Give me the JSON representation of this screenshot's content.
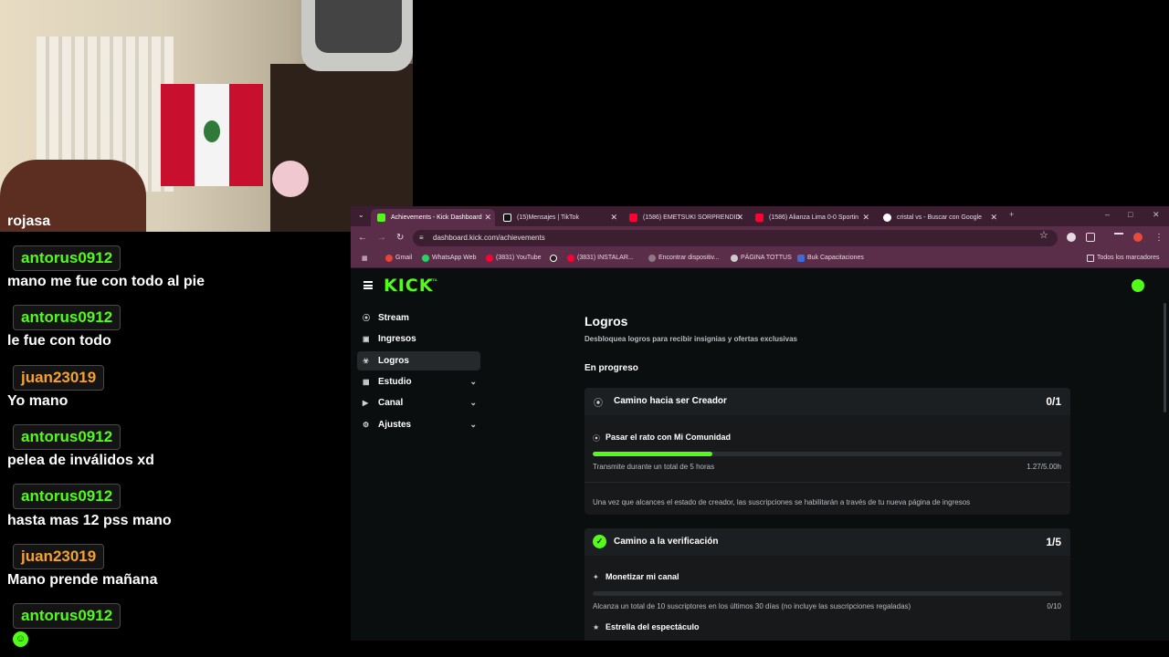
{
  "webcam": {},
  "chat": {
    "messages": [
      {
        "user": "",
        "text": "rojasa"
      },
      {
        "user": "antorus0912",
        "text": "mano me fue con todo al pie",
        "color": "#53fc18"
      },
      {
        "user": "antorus0912",
        "text": "le fue con todo",
        "color": "#53fc18"
      },
      {
        "user": "juan23019",
        "text": "Yo mano",
        "color": "#f3a32d"
      },
      {
        "user": "antorus0912",
        "text": "pelea de inválidos xd",
        "color": "#53fc18"
      },
      {
        "user": "antorus0912",
        "text": "hasta mas 12 pss mano",
        "color": "#53fc18"
      },
      {
        "user": "juan23019",
        "text": "Mano prende mañana",
        "color": "#f3a32d"
      },
      {
        "user": "antorus0912",
        "text": "",
        "color": "#53fc18"
      }
    ],
    "emote_icon": "smile-emote-icon"
  },
  "browser": {
    "tabs": [
      {
        "label": "Achievements - Kick Dashboard",
        "icon": "kick-icon",
        "active": true
      },
      {
        "label": "(15)Mensajes | TikTok",
        "icon": "tiktok-icon"
      },
      {
        "label": "(1586) EMETSUKI SORPRENDID",
        "icon": "youtube-icon"
      },
      {
        "label": "(1586) Alianza Lima 0-0 Sportin",
        "icon": "youtube-icon"
      },
      {
        "label": "cristal vs - Buscar con Google",
        "icon": "google-icon"
      }
    ],
    "url": "dashboard.kick.com/achievements",
    "bookmarks": [
      "Gmail",
      "WhatsApp Web",
      "(3831) YouTube",
      "",
      "(3831) INSTALAR...",
      "Encontrar dispositiv...",
      "PÁGINA TOTTUS",
      "Buk Capacitaciones",
      "Todos los marcadores"
    ]
  },
  "kick": {
    "logo": "KICK",
    "beta": "BETA",
    "sidebar": [
      {
        "label": "Stream",
        "icon": "broadcast-icon"
      },
      {
        "label": "Ingresos",
        "icon": "wallet-icon"
      },
      {
        "label": "Logros",
        "icon": "trophy-icon",
        "active": true
      },
      {
        "label": "Estudio",
        "icon": "studio-icon",
        "expandable": true
      },
      {
        "label": "Canal",
        "icon": "channel-icon",
        "expandable": true
      },
      {
        "label": "Ajustes",
        "icon": "gear-icon",
        "expandable": true
      }
    ],
    "page_title": "Logros",
    "page_subtitle": "Desbloquea logros para recibir insignias y ofertas exclusivas",
    "section_title": "En progreso",
    "cards": [
      {
        "title": "Camino hacia ser Creador",
        "count": "0/1",
        "tasks": [
          {
            "title": "Pasar el rato con Mi Comunidad",
            "desc": "Transmite durante un total de 5 horas",
            "value": "1.27/5.00h",
            "progress": 0.254
          }
        ],
        "note": "Una vez que alcances el estado de creador, las suscripciones se habilitarán a través de tu nueva página de ingresos"
      },
      {
        "title": "Camino a la verificación",
        "count": "1/5",
        "tasks": [
          {
            "title": "Monetizar mi canal",
            "desc": "Alcanza un total de 10 suscriptores en los últimos 30 días (no incluye las suscripciones regaladas)",
            "value": "0/10",
            "progress": 0
          },
          {
            "title": "Estrella del espectáculo"
          }
        ]
      }
    ]
  }
}
